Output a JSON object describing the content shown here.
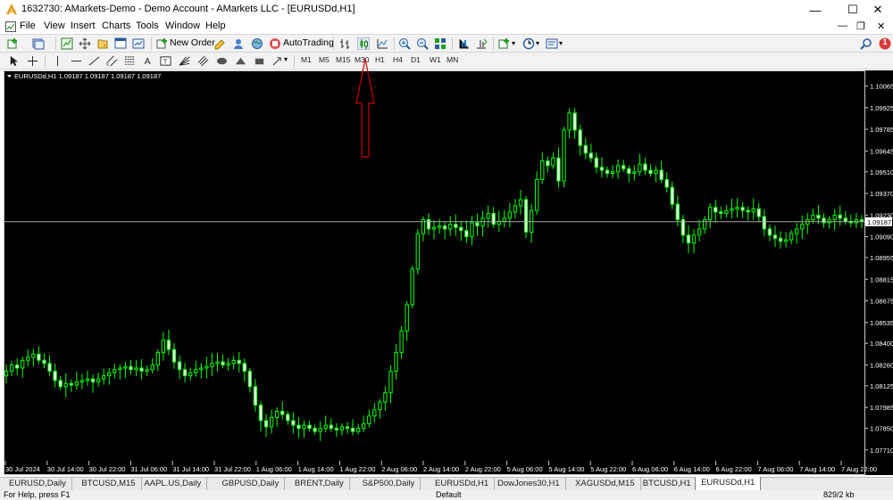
{
  "window": {
    "title": "1632730: AMarkets-Demo - Demo Account - AMarkets LLC - [EURUSDd,H1]",
    "minimize": "—",
    "maximize": "☐",
    "close": "✕"
  },
  "menu": {
    "items": [
      "File",
      "View",
      "Insert",
      "Charts",
      "Tools",
      "Window",
      "Help"
    ],
    "mdi_minimize": "—",
    "mdi_restore": "❐",
    "mdi_close": "✕"
  },
  "toolbar": {
    "new_order": "New Order",
    "auto_trading": "AutoTrading",
    "notification_count": "1",
    "timeframes": [
      "M1",
      "M5",
      "M15",
      "M30",
      "H1",
      "H4",
      "D1",
      "W1",
      "MN"
    ]
  },
  "chart": {
    "info": "EURUSDd,H1  1.09187 1.09187 1.09187 1.09187",
    "current_price": "1.09187",
    "y_ticks": [
      "1.10065",
      "1.09925",
      "1.09785",
      "1.09645",
      "1.09510",
      "1.09370",
      "1.09230",
      "1.09090",
      "1.08955",
      "1.08815",
      "1.08675",
      "1.08535",
      "1.08400",
      "1.08260",
      "1.08125",
      "1.07985",
      "1.07850",
      "1.07710"
    ],
    "x_ticks": [
      "30 Jul 2024",
      "30 Jul 14:00",
      "30 Jul 22:00",
      "31 Jul 06:00",
      "31 Jul 14:00",
      "31 Jul 22:00",
      "1 Aug 06:00",
      "1 Aug 14:00",
      "1 Aug 22:00",
      "2 Aug 06:00",
      "2 Aug 14:00",
      "2 Aug 22:00",
      "5 Aug 06:00",
      "5 Aug 14:00",
      "5 Aug 22:00",
      "6 Aug 06:00",
      "6 Aug 14:00",
      "6 Aug 22:00",
      "7 Aug 06:00",
      "7 Aug 14:00",
      "7 Aug 22:00"
    ]
  },
  "chart_data": {
    "type": "candlestick",
    "symbol": "EURUSDd",
    "timeframe": "H1",
    "ylim": [
      1.0764,
      1.1012
    ],
    "bid_line": 1.09187,
    "closes": [
      1.0822,
      1.0826,
      1.0824,
      1.0829,
      1.0831,
      1.0833,
      1.0829,
      1.0827,
      1.0822,
      1.0816,
      1.0812,
      1.0814,
      1.0813,
      1.0815,
      1.0816,
      1.0817,
      1.0815,
      1.0817,
      1.0819,
      1.0821,
      1.0823,
      1.0824,
      1.0825,
      1.0823,
      1.0824,
      1.0822,
      1.0823,
      1.0826,
      1.0834,
      1.0842,
      1.0836,
      1.0828,
      1.0823,
      1.0819,
      1.0821,
      1.0823,
      1.0824,
      1.0825,
      1.0827,
      1.0828,
      1.0826,
      1.0827,
      1.0829,
      1.0827,
      1.0822,
      1.0812,
      1.08,
      1.079,
      1.0786,
      1.0792,
      1.0796,
      1.0794,
      1.079,
      1.0787,
      1.0785,
      1.0787,
      1.0785,
      1.0783,
      1.0785,
      1.0787,
      1.0785,
      1.0784,
      1.0786,
      1.0785,
      1.0783,
      1.0785,
      1.0788,
      1.0793,
      1.0797,
      1.0802,
      1.0808,
      1.0822,
      1.0834,
      1.0848,
      1.0865,
      1.0888,
      1.0911,
      1.092,
      1.0914,
      1.0915,
      1.0916,
      1.0914,
      1.0917,
      1.0915,
      1.0913,
      1.0909,
      1.0918,
      1.0916,
      1.0921,
      1.0924,
      1.0917,
      1.0919,
      1.0921,
      1.0925,
      1.0929,
      1.0933,
      1.0912,
      1.0926,
      1.0946,
      1.0958,
      1.0955,
      1.096,
      1.0945,
      1.0978,
      1.0989,
      1.0978,
      1.0968,
      1.0963,
      1.096,
      1.0954,
      1.0952,
      1.095,
      1.0951,
      1.0955,
      1.0953,
      1.095,
      1.0951,
      1.0956,
      1.0952,
      1.095,
      1.0952,
      1.0946,
      1.0941,
      1.093,
      1.092,
      1.091,
      1.0905,
      1.091,
      1.0914,
      1.092,
      1.0928,
      1.0925,
      1.0924,
      1.0926,
      1.0927,
      1.0928,
      1.0926,
      1.0925,
      1.0927,
      1.0922,
      1.0914,
      1.091,
      1.0908,
      1.0906,
      1.0907,
      1.0911,
      1.0914,
      1.0917,
      1.092,
      1.0923,
      1.0921,
      1.0918,
      1.092,
      1.0923,
      1.0921,
      1.0919,
      1.0918,
      1.092,
      1.0919
    ]
  },
  "tabs": [
    "EURUSD,Daily",
    "BTCUSD,M15",
    "AAPL.US,Daily",
    "GBPUSD,Daily",
    "BRENT,Daily",
    "S&P500,Daily",
    "EURUSDd,H1",
    "DowJones30,H1",
    "XAGUSDd,M15",
    "BTCUSD,H1",
    "EURUSDd,H1"
  ],
  "active_tab_index": 10,
  "status": {
    "help": "For Help, press F1",
    "profile": "Default",
    "connection": "829/2 kb"
  },
  "colors": {
    "chart_bg": "#000000",
    "bull_candle": "#000000",
    "bull_border": "#00ff00",
    "bear_candle": "#ffffff",
    "bid_line": "#a8a8a8",
    "annotation_arrow": "#cc0000"
  }
}
